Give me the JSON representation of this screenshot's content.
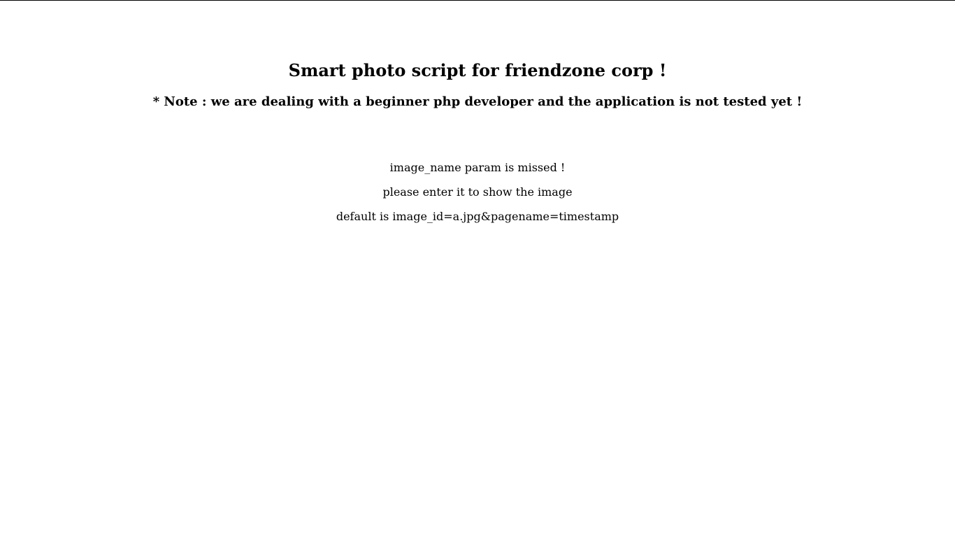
{
  "header": {
    "title": "Smart photo script for friendzone corp !",
    "note": "* Note : we are dealing with a beginner php developer and the application is not tested yet !"
  },
  "messages": [
    "image_name param is missed !",
    "please enter it to show the image",
    "default is image_id=a.jpg&pagename=timestamp"
  ]
}
